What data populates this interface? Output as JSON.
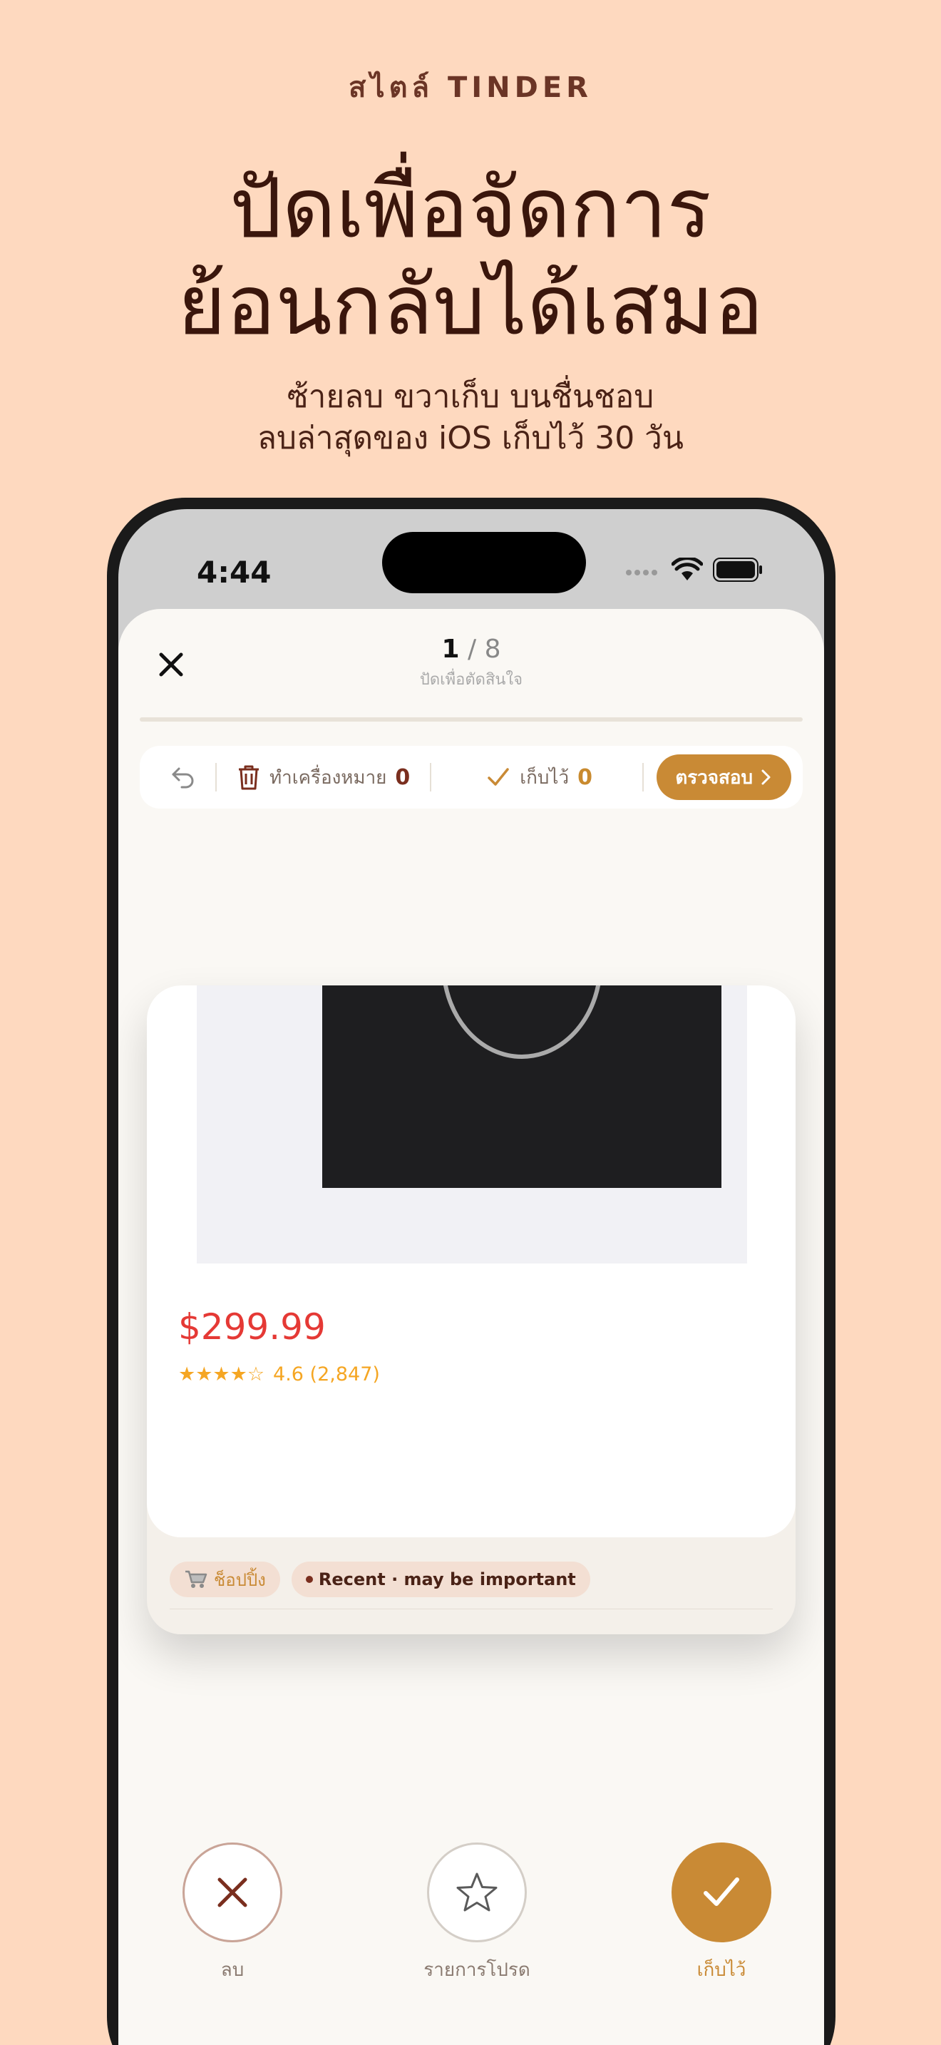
{
  "marketing": {
    "eyebrow": "สไตล์ TINDER",
    "headline_line1": "ปัดเพื่อจัดการ",
    "headline_line2": "ย้อนกลับได้เสมอ",
    "subhead_line1": "ซ้ายลบ ขวาเก็บ บนชื่นชอบ",
    "subhead_line2": "ลบล่าสุดของ iOS เก็บไว้ 30 วัน"
  },
  "status_bar": {
    "time": "4:44"
  },
  "header": {
    "current": "1",
    "separator": "/ 8",
    "hint": "ปัดเพื่อตัดสินใจ"
  },
  "toolbar": {
    "marked_label": "ทำเครื่องหมาย",
    "marked_count": "0",
    "kept_label": "เก็บไว้",
    "kept_count": "0",
    "review_label": "ตรวจสอบ"
  },
  "card": {
    "price": "$299.99",
    "stars": "★★★★☆",
    "rating_text": "4.6 (2,847)",
    "tag_shopping": "ช็อปปิ้ง",
    "tag_recent": "Recent · may be important"
  },
  "actions": {
    "delete_label": "ลบ",
    "favorites_label": "รายการโปรด",
    "keep_label": "เก็บไว้"
  },
  "colors": {
    "background": "#FED9BF",
    "accent": "#C98A35",
    "delete": "#7A2E1E",
    "price": "#E53935",
    "stars": "#F5A623"
  }
}
